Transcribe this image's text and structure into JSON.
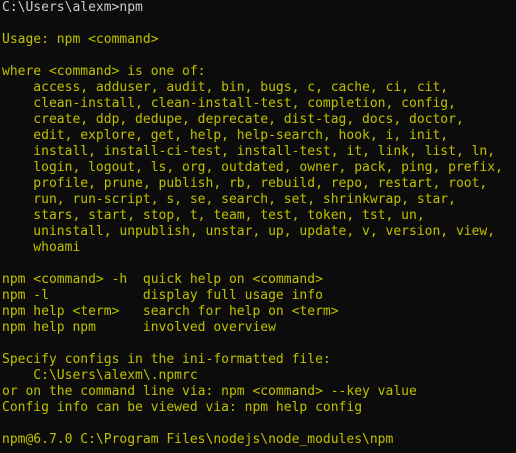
{
  "prompt": {
    "command_line": "C:\\Users\\alexm>npm"
  },
  "usage": {
    "line": "Usage: npm <command>"
  },
  "commands": {
    "header": "where <command> is one of:",
    "lines": [
      "    access, adduser, audit, bin, bugs, c, cache, ci, cit,",
      "    clean-install, clean-install-test, completion, config,",
      "    create, ddp, dedupe, deprecate, dist-tag, docs, doctor,",
      "    edit, explore, get, help, help-search, hook, i, init,",
      "    install, install-ci-test, install-test, it, link, list, ln,",
      "    login, logout, ls, org, outdated, owner, pack, ping, prefix,",
      "    profile, prune, publish, rb, rebuild, repo, restart, root,",
      "    run, run-script, s, se, search, set, shrinkwrap, star,",
      "    stars, start, stop, t, team, test, token, tst, un,",
      "    uninstall, unpublish, unstar, up, update, v, version, view,",
      "    whoami"
    ]
  },
  "help": {
    "lines": [
      "npm <command> -h  quick help on <command>",
      "npm -l            display full usage info",
      "npm help <term>   search for help on <term>",
      "npm help npm      involved overview"
    ]
  },
  "config": {
    "lines": [
      "Specify configs in the ini-formatted file:",
      "    C:\\Users\\alexm\\.npmrc",
      "or on the command line via: npm <command> --key value",
      "Config info can be viewed via: npm help config"
    ]
  },
  "footer": {
    "version_line": "npm@6.7.0 C:\\Program Files\\nodejs\\node_modules\\npm"
  },
  "colors": {
    "background": "#0c0c0c",
    "prompt_text": "#cccccc",
    "output_text": "#c0c000"
  }
}
